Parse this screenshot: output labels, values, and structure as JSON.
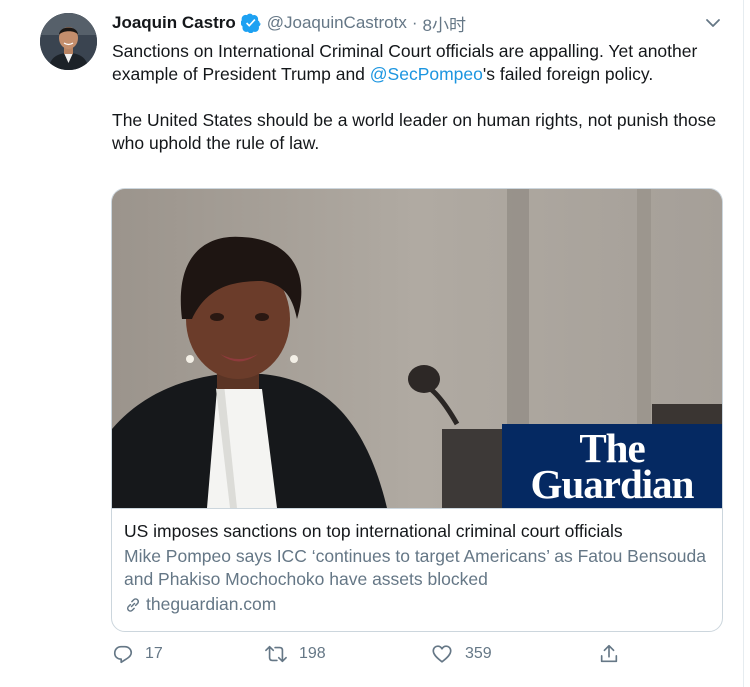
{
  "author": {
    "name": "Joaquin Castro",
    "handle": "@JoaquinCastrotx",
    "separator": "·",
    "time": "8小时"
  },
  "tweet": {
    "line1_before": "Sanctions on International Criminal Court officials are appalling. Yet another example of President Trump and ",
    "mention": "@SecPompeo",
    "line1_after": "'s failed foreign policy.",
    "paragraph2": "The United States should be a world leader on human rights, not punish those who uphold the rule of law."
  },
  "card": {
    "logo_line1": "The",
    "logo_line2": "Guardian",
    "title": "US imposes sanctions on top international criminal court officials",
    "description": "Mike Pompeo says ICC ‘continues to target Americans’ as Fatou Bensouda and Phakiso Mochochoko have assets blocked",
    "domain": "theguardian.com"
  },
  "actions": {
    "reply_count": "17",
    "retweet_count": "198",
    "like_count": "359"
  },
  "icons": {
    "verified": "verified-badge-icon",
    "chevron": "chevron-down-icon",
    "reply": "reply-icon",
    "retweet": "retweet-icon",
    "like": "heart-icon",
    "share": "share-icon",
    "link": "link-icon"
  },
  "colors": {
    "link_blue": "#1b95e0",
    "secondary_text": "#657786",
    "guardian_navy": "#052962"
  }
}
